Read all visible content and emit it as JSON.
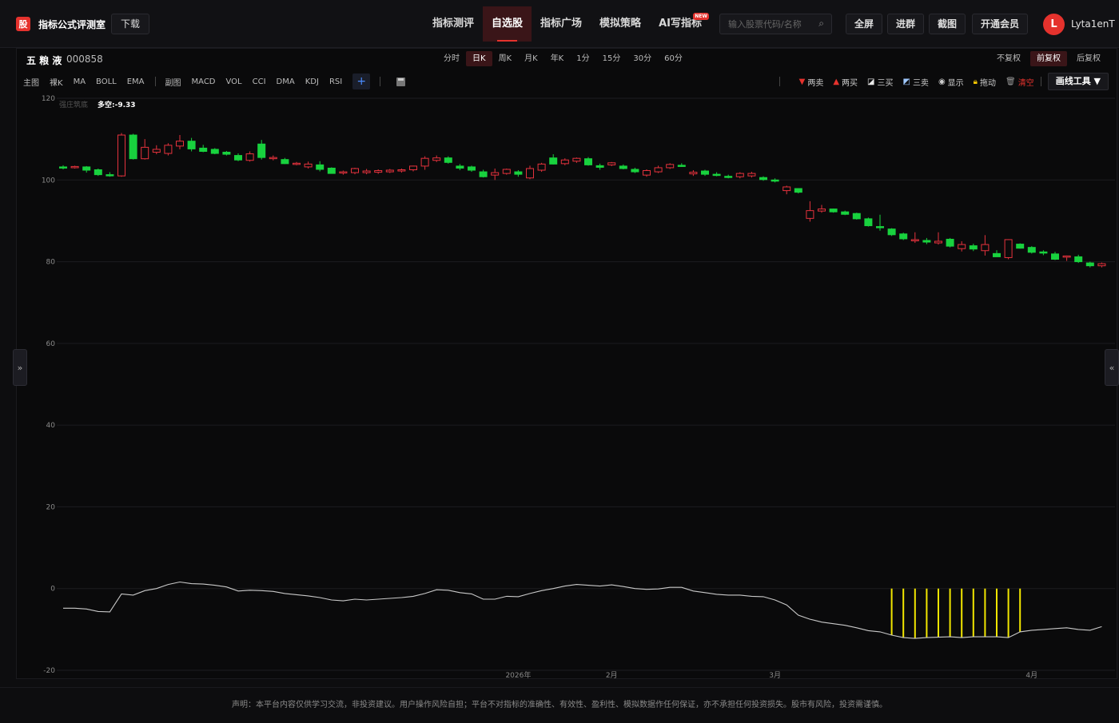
{
  "app": {
    "logo_char": "股",
    "title": "指标公式评测室",
    "download_label": "下载"
  },
  "nav": {
    "items": [
      "指标测评",
      "自选股",
      "指标广场",
      "模拟策略",
      "AI写指标"
    ],
    "active_index": 1,
    "badge": "NEW"
  },
  "search": {
    "placeholder": "输入股票代码/名称"
  },
  "top_buttons": {
    "fullscreen": "全屏",
    "join_group": "进群",
    "screenshot": "截图",
    "membership": "开通会员"
  },
  "user": {
    "avatar_letter": "L",
    "name": "Lyta1enT"
  },
  "stock": {
    "name": "五 粮 液",
    "code": "000858"
  },
  "periods": {
    "items": [
      "分时",
      "日K",
      "周K",
      "月K",
      "年K",
      "1分",
      "15分",
      "30分",
      "60分"
    ],
    "active_index": 1
  },
  "adjust": {
    "items": [
      "不复权",
      "前复权",
      "后复权"
    ],
    "active_index": 1
  },
  "indicators": {
    "main_label": "主图",
    "main": [
      "裸K",
      "MA",
      "BOLL",
      "EMA"
    ],
    "sub_label": "副图",
    "sub": [
      "MACD",
      "VOL",
      "CCI",
      "DMA",
      "KDJ",
      "RSI"
    ],
    "add": "+"
  },
  "tools": {
    "two_sell": "两卖",
    "two_buy": "两买",
    "three_buy": "三买",
    "three_sell": "三卖",
    "show": "显示",
    "drag": "拖动",
    "clear": "清空",
    "draw_tools": "画线工具 ▼"
  },
  "chart_overlay": {
    "indicator_name": "强庄筑底",
    "indicator_value": "多空:-9.33"
  },
  "side_buttons": {
    "left": "»",
    "right": "«"
  },
  "colors": {
    "up": "#e5323d",
    "down": "#18d23e",
    "signal": "#f2e600",
    "line": "#c9c9c9",
    "accent": "#e5322d"
  },
  "chart_data": {
    "type": "candlestick",
    "title": "",
    "ylim": [
      -20,
      120
    ],
    "yticks": [
      120,
      100,
      80,
      60,
      40,
      20,
      0,
      -20
    ],
    "xticks": [
      "2026年",
      "2月",
      "3月",
      "4月"
    ],
    "xtick_index": [
      39,
      47,
      61,
      83
    ],
    "candles": [
      [
        103.2,
        103.6,
        102.6,
        103.0
      ],
      [
        103.0,
        103.5,
        102.8,
        103.3
      ],
      [
        103.2,
        103.4,
        101.8,
        102.4
      ],
      [
        102.5,
        102.8,
        101.0,
        101.3
      ],
      [
        101.3,
        101.9,
        100.8,
        101.1
      ],
      [
        101.0,
        111.5,
        100.8,
        111.0
      ],
      [
        111.0,
        111.3,
        105.0,
        105.2
      ],
      [
        105.2,
        110.0,
        105.0,
        108.0
      ],
      [
        106.8,
        108.5,
        106.3,
        107.5
      ],
      [
        106.5,
        109.0,
        106.0,
        108.5
      ],
      [
        108.3,
        111.0,
        107.5,
        109.5
      ],
      [
        109.5,
        110.3,
        107.0,
        107.6
      ],
      [
        107.8,
        108.6,
        106.8,
        107.0
      ],
      [
        107.5,
        107.8,
        106.3,
        106.5
      ],
      [
        106.8,
        107.1,
        106.0,
        106.3
      ],
      [
        106.0,
        106.5,
        104.6,
        104.9
      ],
      [
        104.8,
        107.0,
        104.5,
        106.4
      ],
      [
        108.8,
        109.8,
        105.0,
        105.5
      ],
      [
        105.3,
        106.0,
        104.8,
        105.5
      ],
      [
        105.0,
        105.4,
        103.9,
        104.0
      ],
      [
        104.0,
        104.4,
        103.6,
        104.1
      ],
      [
        103.2,
        104.5,
        102.8,
        103.9
      ],
      [
        103.7,
        104.6,
        102.1,
        102.6
      ],
      [
        102.9,
        103.1,
        101.8,
        101.6
      ],
      [
        101.7,
        102.3,
        101.3,
        102.0
      ],
      [
        101.8,
        103.0,
        101.4,
        102.8
      ],
      [
        101.8,
        102.7,
        101.4,
        102.2
      ],
      [
        101.9,
        102.6,
        101.5,
        102.3
      ],
      [
        102.0,
        102.7,
        101.7,
        102.4
      ],
      [
        102.2,
        102.8,
        101.8,
        102.5
      ],
      [
        102.5,
        103.5,
        102.1,
        103.4
      ],
      [
        103.4,
        105.8,
        102.5,
        105.3
      ],
      [
        104.8,
        106.0,
        104.4,
        105.4
      ],
      [
        105.4,
        105.8,
        104.0,
        104.3
      ],
      [
        103.4,
        103.9,
        102.4,
        102.9
      ],
      [
        103.2,
        103.5,
        102.0,
        102.4
      ],
      [
        102.0,
        102.5,
        100.6,
        100.8
      ],
      [
        101.2,
        102.8,
        100.0,
        101.8
      ],
      [
        101.6,
        102.8,
        101.3,
        102.6
      ],
      [
        102.0,
        102.4,
        100.8,
        101.4
      ],
      [
        100.5,
        103.5,
        100.2,
        102.8
      ],
      [
        102.4,
        104.2,
        102.0,
        103.9
      ],
      [
        105.4,
        106.3,
        103.8,
        103.9
      ],
      [
        104.0,
        105.3,
        103.6,
        104.9
      ],
      [
        104.6,
        105.5,
        104.2,
        105.3
      ],
      [
        105.2,
        105.6,
        103.5,
        103.7
      ],
      [
        103.5,
        104.0,
        102.5,
        103.1
      ],
      [
        103.7,
        104.4,
        103.4,
        104.2
      ],
      [
        103.4,
        103.8,
        102.6,
        102.8
      ],
      [
        102.6,
        103.0,
        101.7,
        102.0
      ],
      [
        101.2,
        102.6,
        100.8,
        102.3
      ],
      [
        102.0,
        103.5,
        101.7,
        103.0
      ],
      [
        103.0,
        104.1,
        102.7,
        103.8
      ],
      [
        103.6,
        104.1,
        103.2,
        103.3
      ],
      [
        101.5,
        102.4,
        101.0,
        101.9
      ],
      [
        102.2,
        102.5,
        101.0,
        101.4
      ],
      [
        101.4,
        101.9,
        100.9,
        101.1
      ],
      [
        100.9,
        101.3,
        100.4,
        100.6
      ],
      [
        100.8,
        101.9,
        100.4,
        101.6
      ],
      [
        101.0,
        102.0,
        100.6,
        101.6
      ],
      [
        100.6,
        100.9,
        99.8,
        100.1
      ],
      [
        100.0,
        100.4,
        99.4,
        99.9
      ],
      [
        97.4,
        98.6,
        96.5,
        98.3
      ],
      [
        97.9,
        98.0,
        96.7,
        97.0
      ],
      [
        90.6,
        94.8,
        89.8,
        92.5
      ],
      [
        92.4,
        93.9,
        92.0,
        92.9
      ],
      [
        92.9,
        93.0,
        92.0,
        92.2
      ],
      [
        92.2,
        92.5,
        91.4,
        91.6
      ],
      [
        91.8,
        92.0,
        90.3,
        90.5
      ],
      [
        90.5,
        90.8,
        88.6,
        88.8
      ],
      [
        88.6,
        91.5,
        87.6,
        88.4
      ],
      [
        88.0,
        88.2,
        86.3,
        86.6
      ],
      [
        86.8,
        87.1,
        85.3,
        85.6
      ],
      [
        85.4,
        87.2,
        84.6,
        85.4
      ],
      [
        85.2,
        85.8,
        84.3,
        84.8
      ],
      [
        84.6,
        87.2,
        84.2,
        85.0
      ],
      [
        85.5,
        85.8,
        83.5,
        83.8
      ],
      [
        83.2,
        85.0,
        82.5,
        84.2
      ],
      [
        83.9,
        84.4,
        82.6,
        83.1
      ],
      [
        82.7,
        86.5,
        81.5,
        84.2
      ],
      [
        82.0,
        82.8,
        81.2,
        81.2
      ],
      [
        81.0,
        85.5,
        80.6,
        85.4
      ],
      [
        84.3,
        84.5,
        83.2,
        83.3
      ],
      [
        83.5,
        83.8,
        82.0,
        82.3
      ],
      [
        82.4,
        82.8,
        81.6,
        82.1
      ],
      [
        81.9,
        82.4,
        80.4,
        80.6
      ],
      [
        81.3,
        81.5,
        80.2,
        81.4
      ],
      [
        81.2,
        81.7,
        79.7,
        80.0
      ],
      [
        79.7,
        80.0,
        78.6,
        79.0
      ],
      [
        79.0,
        79.8,
        78.6,
        79.5
      ]
    ],
    "indicator_line": [
      -4.8,
      -4.8,
      -5.0,
      -5.6,
      -5.7,
      -1.3,
      -1.6,
      -0.5,
      0.0,
      1.0,
      1.6,
      1.2,
      1.1,
      0.8,
      0.4,
      -0.6,
      -0.4,
      -0.5,
      -0.7,
      -1.2,
      -1.5,
      -1.8,
      -2.2,
      -2.8,
      -3.0,
      -2.6,
      -2.8,
      -2.6,
      -2.4,
      -2.2,
      -1.9,
      -1.2,
      -0.3,
      -0.4,
      -1.0,
      -1.3,
      -2.6,
      -2.6,
      -1.9,
      -2.0,
      -1.2,
      -0.5,
      0.0,
      0.6,
      1.0,
      0.8,
      0.6,
      0.9,
      0.5,
      0.0,
      -0.2,
      -0.1,
      0.3,
      0.3,
      -0.6,
      -1.0,
      -1.4,
      -1.6,
      -1.6,
      -1.9,
      -2.0,
      -2.8,
      -4.0,
      -6.5,
      -7.5,
      -8.2,
      -8.6,
      -9.0,
      -9.6,
      -10.3,
      -10.6,
      -11.4,
      -12.0,
      -12.2,
      -12.0,
      -11.9,
      -11.8,
      -12.0,
      -11.8,
      -11.8,
      -11.8,
      -12.0,
      -10.6,
      -10.2,
      -10.0,
      -9.8,
      -9.6,
      -10.0,
      -10.2,
      -9.33
    ],
    "signal_indices": [
      71,
      72,
      73,
      74,
      75,
      76,
      77,
      78,
      79,
      80,
      81,
      82
    ]
  },
  "footer": {
    "disclaimer": "声明：本平台内容仅供学习交流，非投资建议。用户操作风险自担；平台不对指标的准确性、有效性、盈利性、模拟数据作任何保证，亦不承担任何投资损失。股市有风险，投资需谨慎。"
  }
}
